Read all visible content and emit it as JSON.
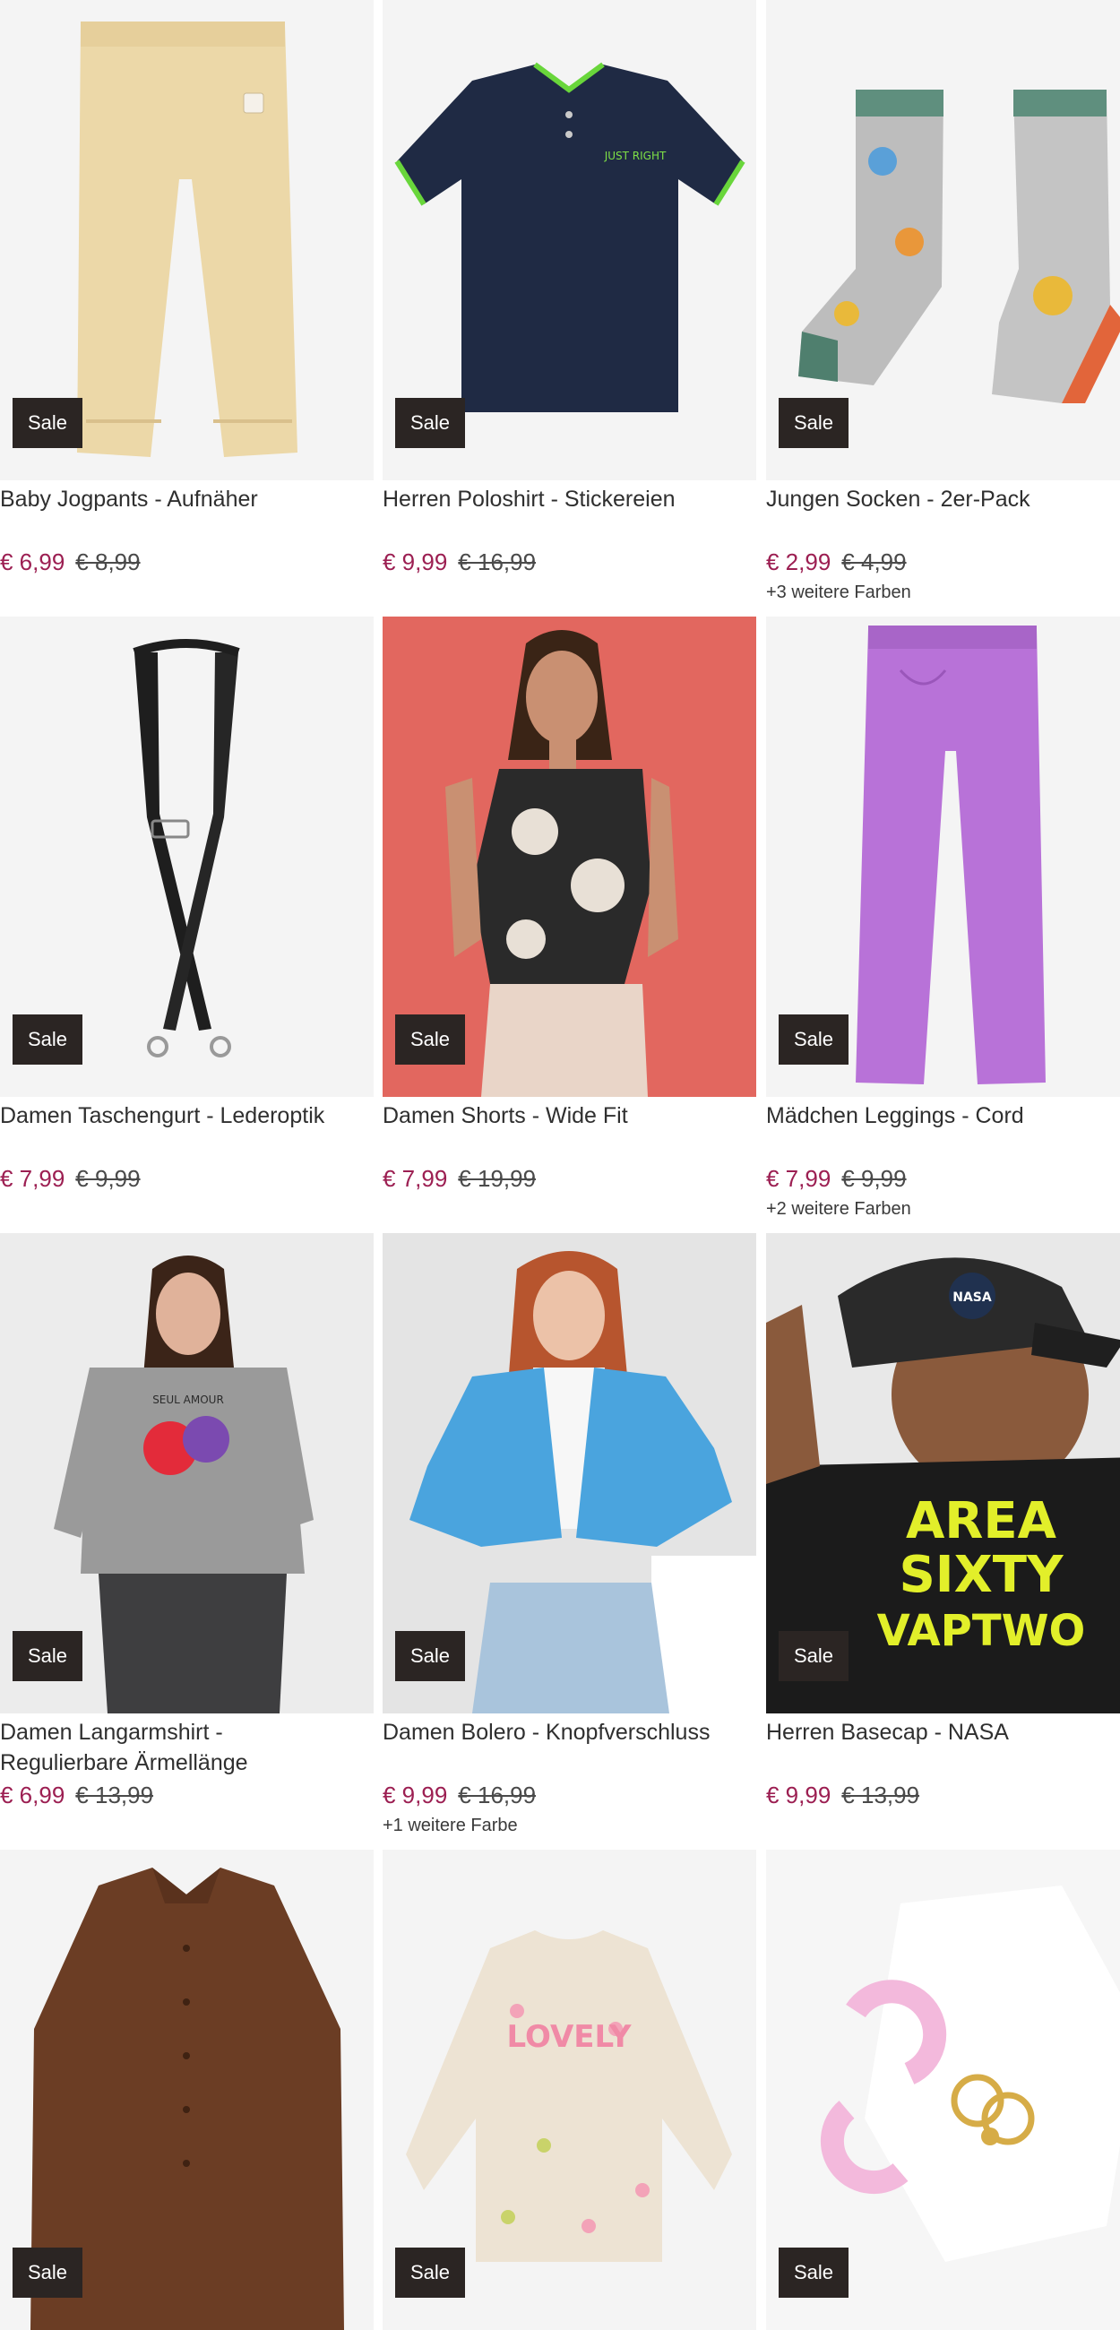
{
  "products": [
    {
      "title": "Baby Jogpants - Aufnäher",
      "badge": "Sale",
      "price": "€ 6,99",
      "old_price": "€ 8,99",
      "colors": ""
    },
    {
      "title": "Herren Poloshirt - Stickereien",
      "badge": "Sale",
      "price": "€ 9,99",
      "old_price": "€ 16,99",
      "colors": ""
    },
    {
      "title": "Jungen Socken - 2er-Pack",
      "badge": "Sale",
      "price": "€ 2,99",
      "old_price": "€ 4,99",
      "colors": "+3 weitere Farben"
    },
    {
      "title": "Damen Taschengurt - Lederoptik",
      "badge": "Sale",
      "price": "€ 7,99",
      "old_price": "€ 9,99",
      "colors": ""
    },
    {
      "title": "Damen Shorts - Wide Fit",
      "badge": "Sale",
      "price": "€ 7,99",
      "old_price": "€ 19,99",
      "colors": ""
    },
    {
      "title": "Mädchen Leggings - Cord",
      "badge": "Sale",
      "price": "€ 7,99",
      "old_price": "€ 9,99",
      "colors": "+2 weitere Farben"
    },
    {
      "title": "Damen Langarmshirt -\nRegulierbare Ärmellänge",
      "badge": "Sale",
      "price": "€ 6,99",
      "old_price": "€ 13,99",
      "colors": ""
    },
    {
      "title": "Damen Bolero - Knopfverschluss",
      "badge": "Sale",
      "price": "€ 9,99",
      "old_price": "€ 16,99",
      "colors": "+1 weitere Farbe"
    },
    {
      "title": "Herren Basecap - NASA",
      "badge": "Sale",
      "price": "€ 9,99",
      "old_price": "€ 13,99",
      "colors": ""
    },
    {
      "title": "",
      "badge": "Sale",
      "price": "",
      "old_price": "",
      "colors": ""
    },
    {
      "title": "",
      "badge": "Sale",
      "price": "",
      "old_price": "",
      "colors": ""
    },
    {
      "title": "",
      "badge": "Sale",
      "price": "",
      "old_price": "",
      "colors": ""
    }
  ],
  "image_texts": {
    "polo_logo": "JUST RIGHT",
    "shirt_print": "SEUL AMOUR",
    "cap_patch": "NASA",
    "tee_print_1": "AREA",
    "tee_print_2": "SIXTY",
    "tee_print_3": "VAPTWO",
    "sweater_print": "LOVELY"
  },
  "colors": {
    "price": "#9c1f52",
    "sale_badge": "#2b2523",
    "image_bg": "#f3f3f3"
  }
}
